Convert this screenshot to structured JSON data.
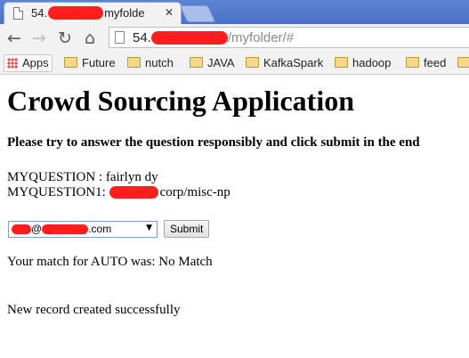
{
  "browser": {
    "tab_title_prefix": "54.",
    "tab_title_suffix": "myfolde",
    "tab_close_icon": "close-icon",
    "url_host_prefix": "54.",
    "url_path": "/myfolder/#",
    "bookmarks": [
      {
        "label": "Apps",
        "icon": "apps-grid-icon"
      },
      {
        "label": "Future",
        "icon": "folder-icon"
      },
      {
        "label": "nutch",
        "icon": "folder-icon"
      },
      {
        "label": "JAVA",
        "icon": "folder-icon"
      },
      {
        "label": "KafkaSpark",
        "icon": "folder-icon"
      },
      {
        "label": "hadoop",
        "icon": "folder-icon"
      },
      {
        "label": "feed",
        "icon": "folder-icon"
      }
    ]
  },
  "page": {
    "title": "Crowd Sourcing Application",
    "instructions": "Please try to answer the question responsibly and click submit in the end",
    "question_label": "MYQUESTION : ",
    "question_value": "fairlyn dy",
    "question1_label": "MYQUESTION1: ",
    "question1_value": "corp/misc-np",
    "email_at": "@",
    "email_suffix": ".com",
    "submit_label": "Submit",
    "match_text": "Your match for AUTO was: No Match",
    "record_text": "New record created successfully"
  },
  "colors": {
    "redaction": "#ff1e1e",
    "tabstrip": "#4a72c6"
  }
}
